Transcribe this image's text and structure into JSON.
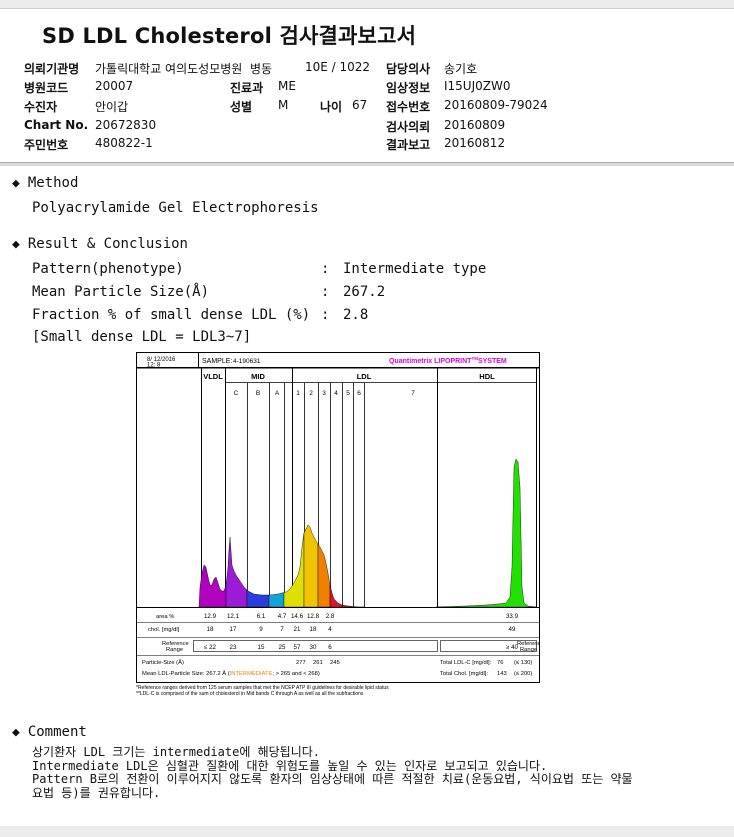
{
  "title": "SD LDL Cholesterol 검사결과보고서",
  "header": {
    "rows": [
      [
        {
          "k": "의뢰기관명",
          "v": "가톨릭대학교 여의도성모병원"
        },
        {
          "k": "병동",
          "v": "10E / 1022"
        },
        {
          "k": "담당의사",
          "v": "송기호"
        }
      ],
      [
        {
          "k": "병원코드",
          "v": "20007"
        },
        {
          "k": "진료과",
          "v": "ME"
        },
        {
          "k": "임상정보",
          "v": "I15UJ0ZW0"
        }
      ],
      [
        {
          "k": "수진자",
          "v": "안이갑"
        },
        {
          "k": "성별",
          "v": "M"
        },
        {
          "k": "나이",
          "v": "67"
        },
        {
          "k": "접수번호",
          "v": "20160809-79024"
        }
      ],
      [
        {
          "k": "Chart No.",
          "v": "20672830"
        },
        {
          "k": "검사의뢰",
          "v": "20160809"
        }
      ],
      [
        {
          "k": "주민번호",
          "v": "480822-1"
        },
        {
          "k": "결과보고",
          "v": "20160812"
        }
      ]
    ]
  },
  "method": {
    "heading": "Method",
    "text": "Polyacrylamide Gel Electrophoresis"
  },
  "result": {
    "heading": "Result & Conclusion",
    "items": [
      {
        "label": "Pattern(phenotype)",
        "sep": ":",
        "value": "Intermediate type"
      },
      {
        "label": "Mean Particle Size(Å)",
        "sep": ":",
        "value": "267.2"
      },
      {
        "label": "Fraction % of small dense LDL (%)",
        "sep": ":",
        "value": "2.8"
      }
    ],
    "note": "[Small dense LDL = LDL3~7]"
  },
  "lipoprint": {
    "date": "8/ 12/2016",
    "time": "12: 8",
    "sample_label": "SAMPLE:",
    "sample": "4-190631",
    "brand": "Quantimetrix LIPOPRINT",
    "brand_tm": "TM",
    "brand_suffix": "SYSTEM",
    "bands": {
      "vldl": "VLDL",
      "mid": "MID",
      "ldl": "LDL",
      "hdl": "HDL"
    },
    "mid_sub": [
      "C",
      "B",
      "A"
    ],
    "ldl_sub": [
      "1",
      "2",
      "3",
      "4",
      "5",
      "6",
      "7"
    ],
    "area_label": "area %",
    "area_values": [
      "12.9",
      "12.1",
      "6.1",
      "4.7",
      "14.6",
      "12.8",
      "2.8"
    ],
    "area_hdl": "33.9",
    "chol_label": "chol. [mg/dl]",
    "chol_values": [
      "18",
      "17",
      "9",
      "7",
      "21",
      "18",
      "4"
    ],
    "chol_hdl": "49",
    "ref_label_1": "Reference",
    "ref_label_2": "Range",
    "ref_values": [
      "≤ 22",
      "23",
      "15",
      "25",
      "57",
      "30",
      "6"
    ],
    "ref_hdl": "≥ 40",
    "particle_size_label": "Particle-Size (Å)",
    "particle_sizes": [
      "277",
      "261",
      "245"
    ],
    "mean_label": "Mean LDL-Particle Size:",
    "mean_value": "267.2 Å (",
    "mean_type": "INTERMEDIATE",
    "mean_suffix": "; > 265 and < 268)",
    "total_ldl_label": "Total LDL-C [mg/dl]:",
    "total_ldl": "76",
    "total_ldl_range": "(≤ 130)",
    "total_chol_label": "Total Chol. [mg/dl]:",
    "total_chol": "143",
    "total_chol_range": "(≤ 200)",
    "footnote1": "*Reference ranges derived from 125 serum samples that met the NCEP ATP III guidelines for desirable lipid status",
    "footnote2": "**LDL-C is comprised of the sum of cholesterol in Mid bands C through A as well as all the subfractions"
  },
  "comment": {
    "heading": "Comment",
    "lines": [
      "상기환자 LDL 크기는 intermediate에 해당됩니다.",
      "Intermediate LDL은 심혈관 질환에 대한 위험도를 높일 수 있는 인자로 보고되고 있습니다.",
      "Pattern B로의 전환이 이루어지지 않도록 환자의 임상상태에 따른 적절한 치료(운동요법, 식이요법 또는 약물",
      "요법 등)를 권유합니다."
    ]
  },
  "colors": {
    "vldl": "#b000c0",
    "mid_c": "#9b1bd6",
    "mid_b": "#2a3ee0",
    "mid_a": "#14a3d6",
    "ldl1": "#e0e000",
    "ldl2": "#f0c400",
    "ldl3": "#f08000",
    "ldl4": "#e01030",
    "hdl": "#22e000"
  }
}
